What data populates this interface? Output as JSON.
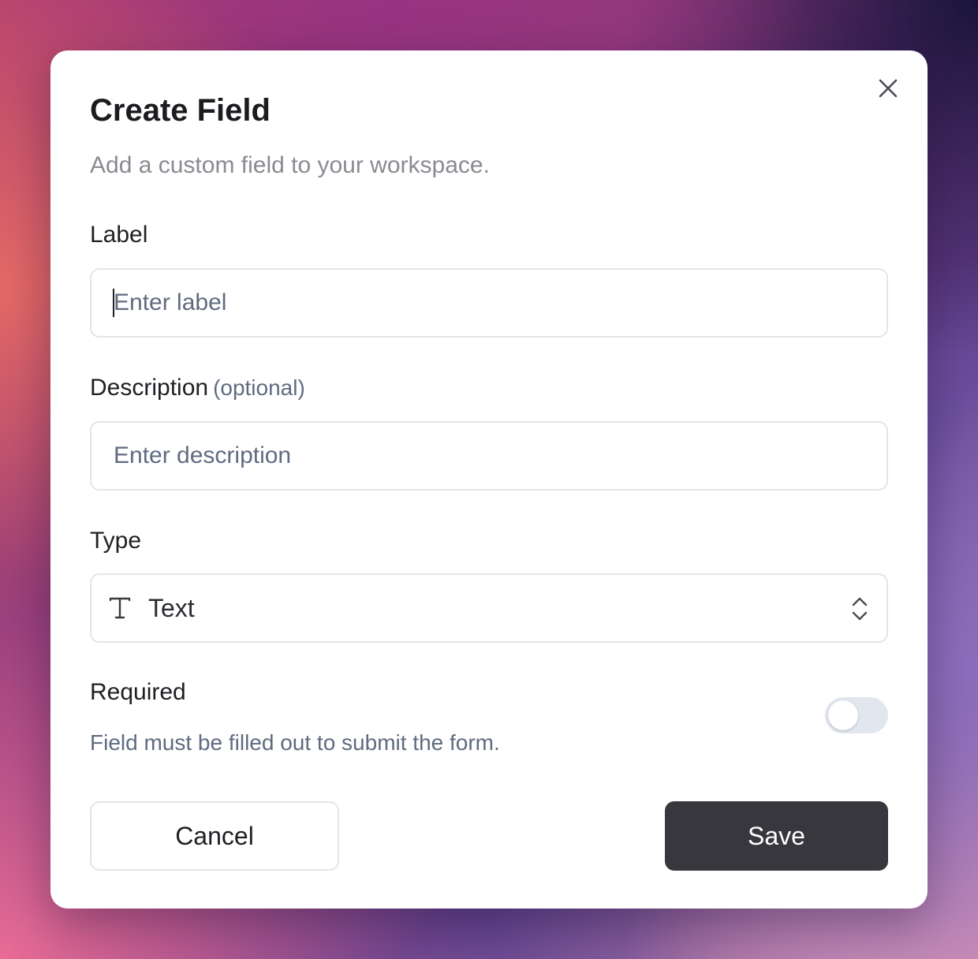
{
  "dialog": {
    "title": "Create Field",
    "subtitle": "Add a custom field to your workspace.",
    "close_icon": "close-icon"
  },
  "label_field": {
    "label": "Label",
    "placeholder": "Enter label",
    "value": ""
  },
  "description_field": {
    "label": "Description",
    "optional_hint": "(optional)",
    "placeholder": "Enter description",
    "value": ""
  },
  "type_field": {
    "label": "Type",
    "selected": "Text",
    "selected_icon": "text-type-icon",
    "chevron_icon": "chevron-up-down-icon"
  },
  "required_field": {
    "label": "Required",
    "help_text": "Field must be filled out to submit the form.",
    "enabled": false
  },
  "actions": {
    "cancel_label": "Cancel",
    "save_label": "Save"
  },
  "colors": {
    "save_button_bg": "#37373d",
    "toggle_off_bg": "#e2e6ee",
    "muted_text": "#5f6b80"
  }
}
